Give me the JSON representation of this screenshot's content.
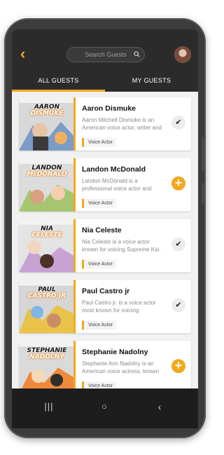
{
  "header": {
    "search_placeholder": "Search Guests",
    "back_icon": "chevron-left-icon",
    "avatar_icon": "user-avatar"
  },
  "tabs": [
    {
      "label": "ALL GUESTS",
      "active": true
    },
    {
      "label": "MY GUESTS",
      "active": false
    }
  ],
  "colors": {
    "accent": "#f2a81e",
    "dark": "#2b2b2b"
  },
  "guests": [
    {
      "name": "Aaron Dismuke",
      "description": "Aaron Mitchell Dismuke is an American voice actor, writer and ...",
      "tag": "Voice Actor",
      "cover_title_1": "AARON",
      "cover_title_2": "DISMUKE",
      "action": "check"
    },
    {
      "name": "Landon McDonald",
      "description": "Landon McDonald is a professional voice actor and scre...",
      "tag": "Voice Actor",
      "cover_title_1": "LANDON",
      "cover_title_2": "McDONALD",
      "action": "add"
    },
    {
      "name": "Nia Celeste",
      "description": "Nia Celeste is a voice actor known for voicing Supreme Kai.",
      "tag": "Voice Actor",
      "cover_title_1": "NIA",
      "cover_title_2": "CELESTE",
      "action": "check"
    },
    {
      "name": "Paul Castro jr",
      "description": "Paul Castro jr. is a voice actor most known for voicing Freminet...",
      "tag": "Voice Actor",
      "cover_title_1": "PAUL",
      "cover_title_2": "CASTRO JR",
      "action": "check"
    },
    {
      "name": "Stephanie Nadolny",
      "description": "Stephanie Ann Nadolny is an American voice actress, known f...",
      "tag": "Voice Actor",
      "cover_title_1": "STEPHANIE",
      "cover_title_2": "NADOLNY",
      "action": "add"
    }
  ],
  "navbar": {
    "recents": "|||",
    "home": "○",
    "back": "‹"
  }
}
